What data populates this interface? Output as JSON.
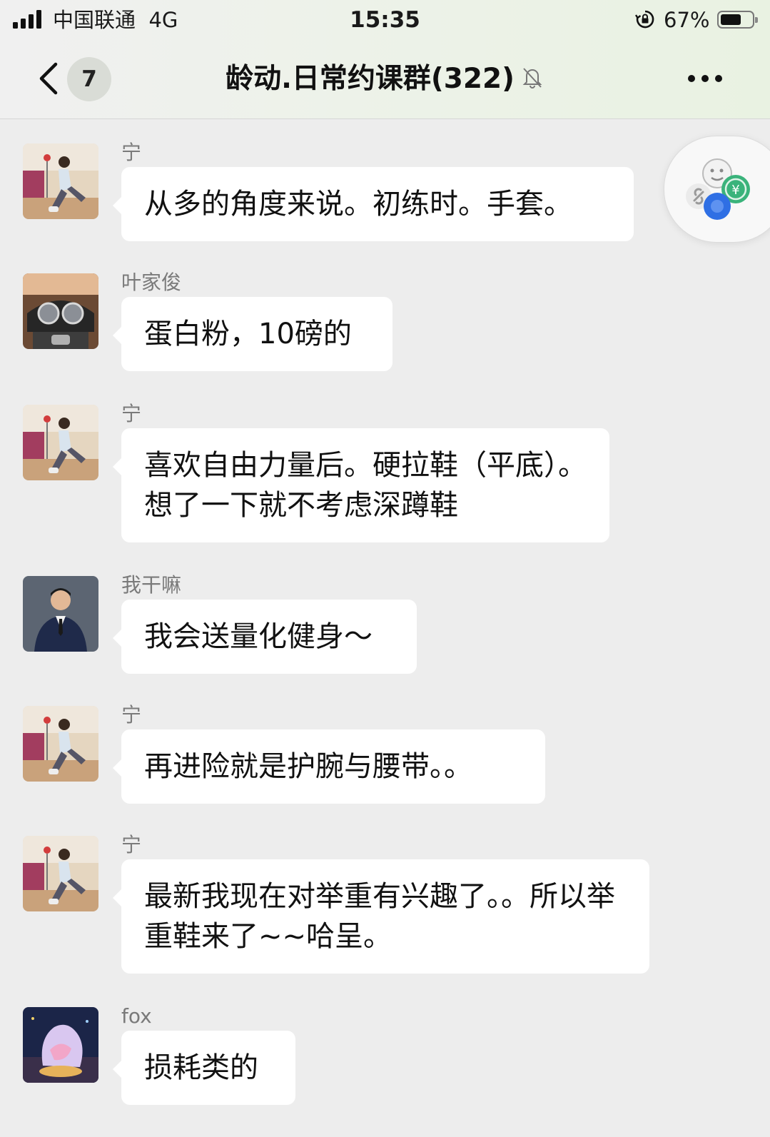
{
  "status_bar": {
    "carrier": "中国联通",
    "network": "4G",
    "time": "15:35",
    "battery_percent": "67%",
    "battery_level": 0.67,
    "signal_bars": 4,
    "icons": [
      "signal-icon",
      "rotation-lock-icon",
      "battery-icon"
    ]
  },
  "nav": {
    "back_icon": "chevron-left-icon",
    "unread_count": "7",
    "title": "龄动.日常约课群(322)",
    "muted_icon": "bell-muted-icon",
    "more_icon": "more-dots-icon"
  },
  "floating": {
    "icons": [
      "link-icon",
      "emoji-icon",
      "coin-icon",
      "dot-icon"
    ]
  },
  "messages": [
    {
      "sender": "宁",
      "text": "从多的角度来说。初练时。手套。"
    },
    {
      "sender": "叶家俊",
      "text": "蛋白粉，10磅的"
    },
    {
      "sender": "宁",
      "text": "喜欢自由力量后。硬拉鞋（平底）。想了一下就不考虑深蹲鞋"
    },
    {
      "sender": "我干嘛",
      "text": "我会送量化健身～"
    },
    {
      "sender": "宁",
      "text": "再进险就是护腕与腰带。。"
    },
    {
      "sender": "宁",
      "text": "最新我现在对举重有兴趣了。。所以举重鞋来了~~哈呈。"
    },
    {
      "sender": "fox",
      "text": "损耗类的"
    }
  ],
  "colors": {
    "background": "#ededed",
    "bubble": "#ffffff",
    "header_tint": "#e9f2e2",
    "sender_text": "#7a7a7a"
  }
}
